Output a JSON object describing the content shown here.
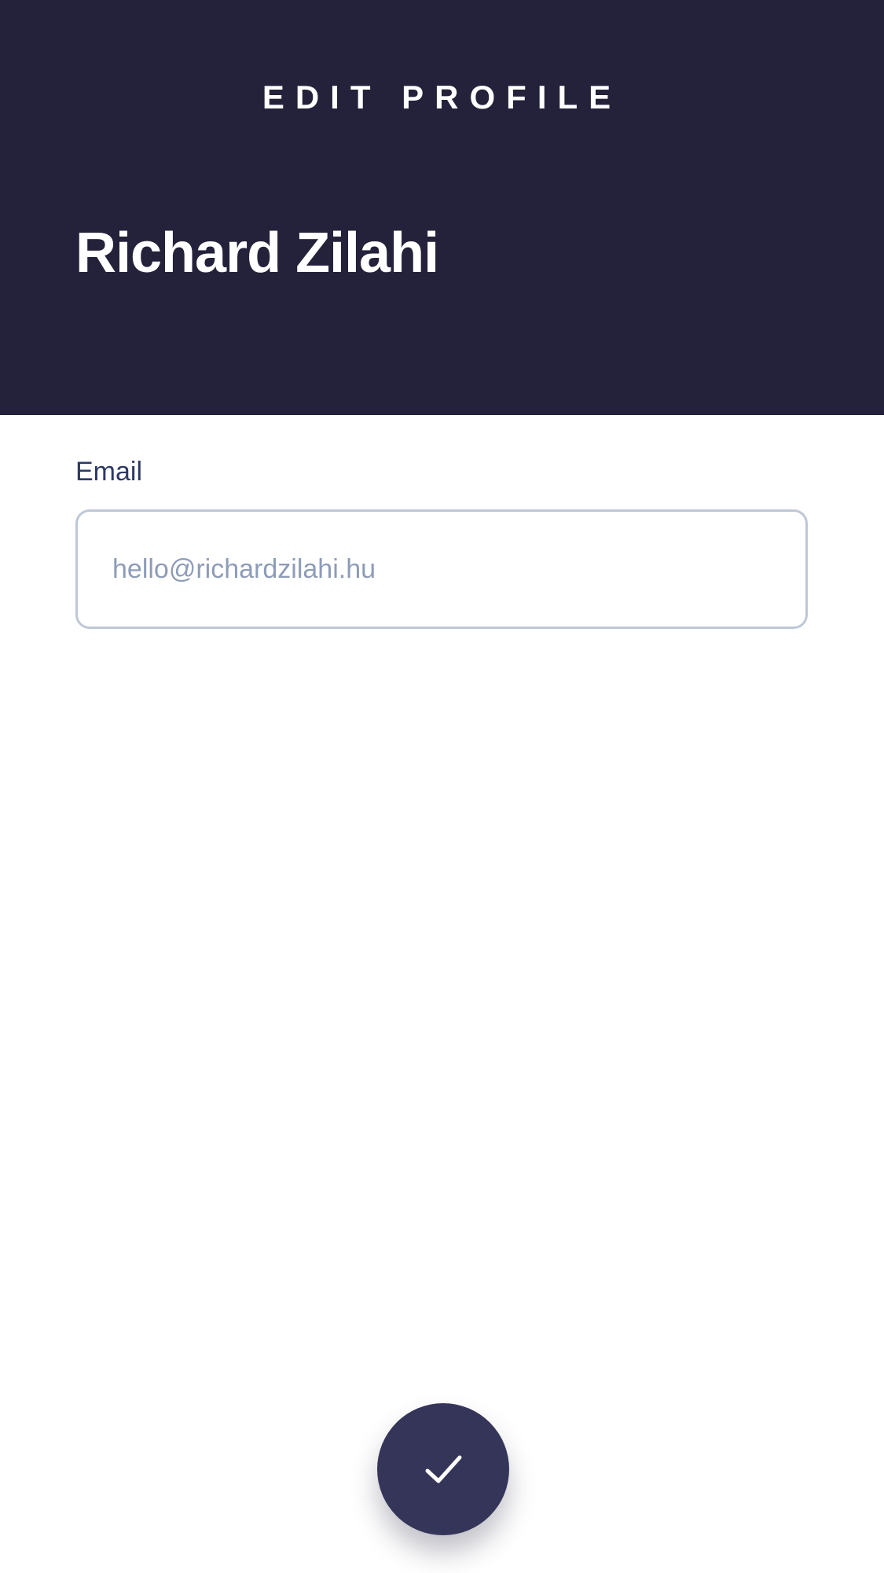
{
  "header": {
    "title": "EDIT PROFILE",
    "name": "Richard Zilahi"
  },
  "form": {
    "email_label": "Email",
    "email_value": "hello@richardzilahi.hu"
  },
  "actions": {
    "save_icon": "check-icon"
  },
  "colors": {
    "header_background": "#23223a",
    "button_background": "#35355a",
    "label_text": "#2c3a64",
    "field_border": "#bfc7d6",
    "field_text": "#8e9cb8"
  }
}
